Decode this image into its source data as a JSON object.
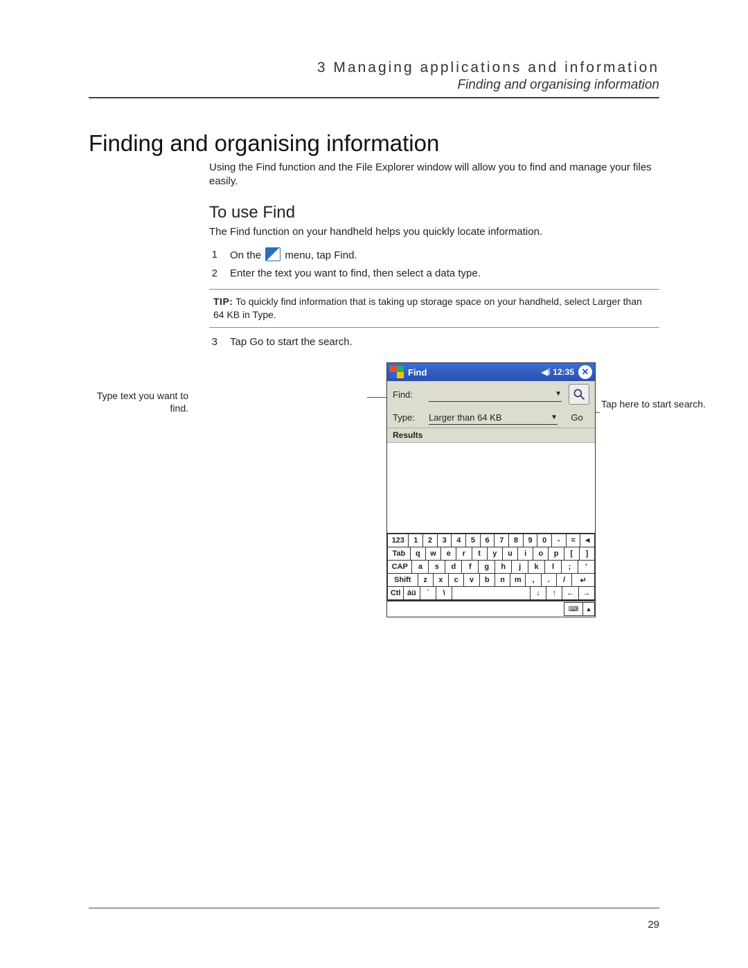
{
  "header": {
    "chapter": "3 Managing applications and information",
    "section": "Finding and organising information"
  },
  "h1": "Finding and organising information",
  "intro": "Using the Find function and the File Explorer window will allow you to find and manage your files easily.",
  "h2": "To use Find",
  "lead": "The Find function on your handheld helps you quickly locate information.",
  "steps": {
    "s1a": "On the",
    "s1b": "menu, tap Find.",
    "s2": "Enter the text you want to find, then select a data type.",
    "s3": "Tap Go to start the search."
  },
  "tip": {
    "label": "TIP:",
    "text": "To quickly find information that is taking up storage space on your handheld, select Larger than 64 KB in Type."
  },
  "callouts": {
    "left": "Type text you want to find.",
    "right": "Tap here to start search."
  },
  "device": {
    "title": "Find",
    "time": "12:35",
    "findLabel": "Find:",
    "typeLabel": "Type:",
    "typeValue": "Larger than 64 KB",
    "go": "Go",
    "results": "Results",
    "kbd": {
      "row1": [
        "123",
        "1",
        "2",
        "3",
        "4",
        "5",
        "6",
        "7",
        "8",
        "9",
        "0",
        "-",
        "=",
        "◄"
      ],
      "row2": [
        "Tab",
        "q",
        "w",
        "e",
        "r",
        "t",
        "y",
        "u",
        "i",
        "o",
        "p",
        "[",
        "]"
      ],
      "row3": [
        "CAP",
        "a",
        "s",
        "d",
        "f",
        "g",
        "h",
        "j",
        "k",
        "l",
        ";",
        "'"
      ],
      "row4": [
        "Shift",
        "z",
        "x",
        "c",
        "v",
        "b",
        "n",
        "m",
        ",",
        ".",
        "/",
        "↵"
      ],
      "row5": [
        "Ctl",
        "áü",
        "`",
        "\\",
        "",
        "↓",
        "↑",
        "←",
        "→"
      ]
    }
  },
  "pageNumber": "29"
}
